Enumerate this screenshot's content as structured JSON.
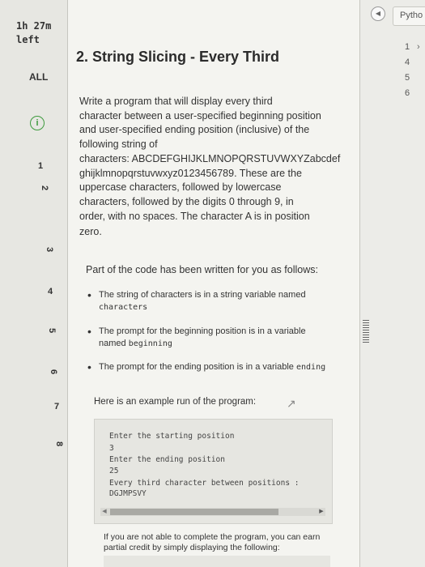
{
  "sidebar": {
    "timer_line1": "1h 27m",
    "timer_line2": "left",
    "all_label": "ALL",
    "info_icon": "info-icon",
    "questions": [
      "1",
      "2",
      "3",
      "4",
      "5",
      "6",
      "7",
      "8"
    ]
  },
  "main": {
    "title": "2. String Slicing - Every Third",
    "description_lines": [
      "Write a program that will display every third",
      "character between a user-specified beginning position",
      "and user-specified ending position (inclusive) of the",
      "following string of",
      "characters: ABCDEFGHIJKLMNOPQRSTUVWXYZabcdef",
      "ghijklmnopqrstuvwxyz0123456789.  These are the",
      "uppercase characters, followed by lowercase",
      "characters, followed by the digits 0 through 9, in",
      "order, with no spaces. The character A is in position",
      "zero."
    ],
    "intro": "Part of the code has been written for you as follows:",
    "bullets": [
      {
        "text": "The string of characters is in a string variable named",
        "code": "characters"
      },
      {
        "text": "The prompt for the beginning position is in a variable named",
        "code": "beginning"
      },
      {
        "text": "The prompt for the ending position is in a variable",
        "code": "ending"
      }
    ],
    "example_lead": "Here is an example run of the program:",
    "example_output": [
      "Enter the starting position",
      "3",
      "Enter the ending position",
      "25",
      "Every third character between positions :",
      "DGJMPSVY"
    ],
    "partial_credit": "If you are not able to complete the program, you can earn partial credit by simply displaying the following:"
  },
  "right_panel": {
    "tab_label": "Pytho",
    "line_numbers": [
      "1",
      "4",
      "5",
      "6"
    ]
  }
}
